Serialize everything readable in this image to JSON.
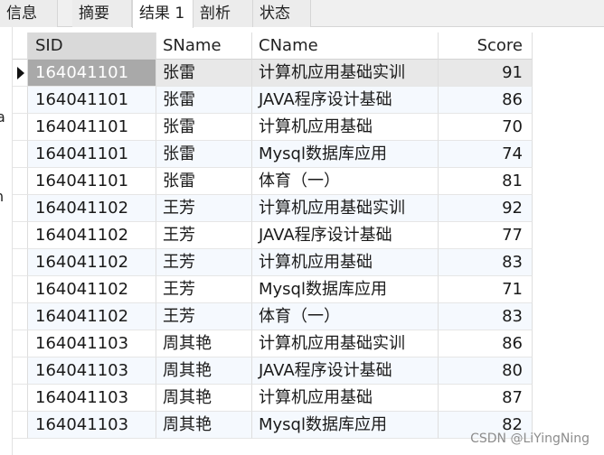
{
  "tabs": [
    {
      "label": "信息"
    },
    {
      "label": "摘要"
    },
    {
      "label": "结果 1"
    },
    {
      "label": "剖析"
    },
    {
      "label": "状态"
    }
  ],
  "left_edge": [
    "a",
    "n"
  ],
  "table": {
    "columns": [
      "SID",
      "SName",
      "CName",
      "Score"
    ],
    "rows": [
      {
        "sid": "164041101",
        "sname": "张雷",
        "cname": "计算机应用基础实训",
        "score": "91"
      },
      {
        "sid": "164041101",
        "sname": "张雷",
        "cname": "JAVA程序设计基础",
        "score": "86"
      },
      {
        "sid": "164041101",
        "sname": "张雷",
        "cname": "计算机应用基础",
        "score": "70"
      },
      {
        "sid": "164041101",
        "sname": "张雷",
        "cname": "Mysql数据库应用",
        "score": "74"
      },
      {
        "sid": "164041101",
        "sname": "张雷",
        "cname": "体育（一）",
        "score": "81"
      },
      {
        "sid": "164041102",
        "sname": "王芳",
        "cname": "计算机应用基础实训",
        "score": "92"
      },
      {
        "sid": "164041102",
        "sname": "王芳",
        "cname": "JAVA程序设计基础",
        "score": "77"
      },
      {
        "sid": "164041102",
        "sname": "王芳",
        "cname": "计算机应用基础",
        "score": "83"
      },
      {
        "sid": "164041102",
        "sname": "王芳",
        "cname": "Mysql数据库应用",
        "score": "71"
      },
      {
        "sid": "164041102",
        "sname": "王芳",
        "cname": "体育（一）",
        "score": "83"
      },
      {
        "sid": "164041103",
        "sname": "周其艳",
        "cname": "计算机应用基础实训",
        "score": "86"
      },
      {
        "sid": "164041103",
        "sname": "周其艳",
        "cname": "JAVA程序设计基础",
        "score": "80"
      },
      {
        "sid": "164041103",
        "sname": "周其艳",
        "cname": "计算机应用基础",
        "score": "87"
      },
      {
        "sid": "164041103",
        "sname": "周其艳",
        "cname": "Mysql数据库应用",
        "score": "82"
      }
    ]
  },
  "watermark": "CSDN @LiYingNing"
}
